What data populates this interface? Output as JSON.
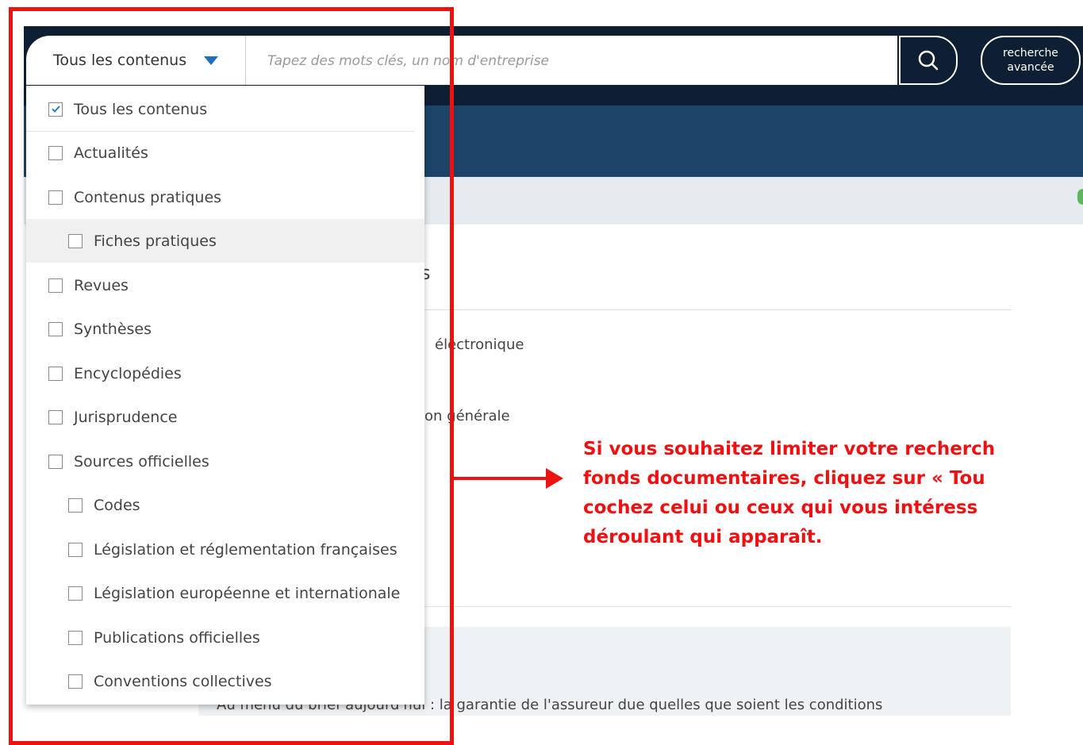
{
  "search": {
    "scope_label": "Tous les contenus",
    "placeholder": "Tapez des mots clés, un nom d'entreprise",
    "search_icon": "search-icon",
    "advanced_line1": "recherche",
    "advanced_line2": "avancée"
  },
  "dropdown": {
    "items": [
      {
        "label": "Tous les contenus",
        "checked": true
      },
      {
        "label": "Actualités",
        "checked": false
      },
      {
        "label": "Contenus pratiques",
        "checked": false
      },
      {
        "label": "Fiches pratiques",
        "checked": false
      },
      {
        "label": "Revues",
        "checked": false
      },
      {
        "label": "Synthèses",
        "checked": false
      },
      {
        "label": "Encyclopédies",
        "checked": false
      },
      {
        "label": "Jurisprudence",
        "checked": false
      },
      {
        "label": "Sources officielles",
        "checked": false
      },
      {
        "label": "Codes",
        "checked": false
      },
      {
        "label": "Législation et réglementation françaises",
        "checked": false
      },
      {
        "label": "Législation européenne et internationale",
        "checked": false
      },
      {
        "label": "Publications officielles",
        "checked": false
      },
      {
        "label": "Conventions collectives",
        "checked": false
      }
    ]
  },
  "background": {
    "heading_fragment": "s",
    "line1_fragment": "électronique",
    "line2_fragment": "on générale",
    "brief_text": "Au menu du brief aujourd'hui : la garantie de l'assureur due quelles que soient les conditions"
  },
  "annotation": {
    "line1": "Si vous souhaitez limiter votre recherch",
    "line2": "fonds documentaires, cliquez sur « Tou",
    "line3": "cochez celui ou ceux qui vous intéress",
    "line4": "déroulant qui apparaît."
  },
  "colors": {
    "header_dark": "#0f1f33",
    "header_mid": "#1b4468",
    "annotation_red": "#ee1111",
    "caret_blue": "#1f6fc1"
  }
}
